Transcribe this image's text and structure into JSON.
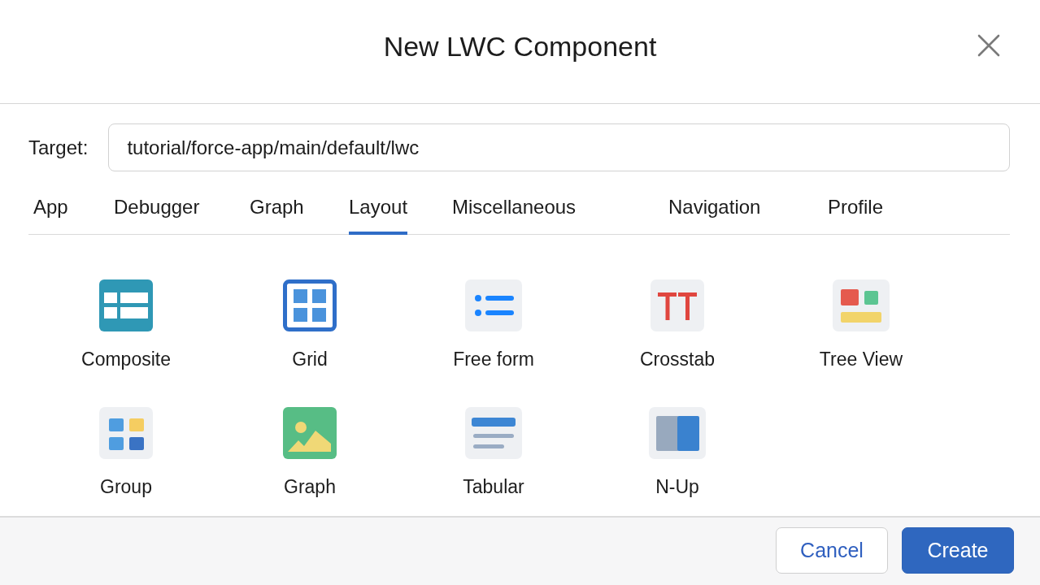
{
  "dialog": {
    "title": "New LWC Component"
  },
  "target": {
    "label": "Target:",
    "value": "tutorial/force-app/main/default/lwc"
  },
  "tabs": [
    {
      "label": "App",
      "selected": false
    },
    {
      "label": "Debugger",
      "selected": false
    },
    {
      "label": "Graph",
      "selected": false
    },
    {
      "label": "Layout",
      "selected": true
    },
    {
      "label": "Miscellaneous",
      "selected": false
    },
    {
      "label": "Navigation",
      "selected": false
    },
    {
      "label": "Profile",
      "selected": false
    }
  ],
  "components": [
    "Composite",
    "Grid",
    "Free form",
    "Crosstab",
    "Tree View",
    "Group",
    "Graph",
    "Tabular",
    "N-Up"
  ],
  "buttons": [
    {
      "label": "Cancel",
      "kind": "secondary"
    },
    {
      "label": "Create",
      "kind": "primary"
    }
  ]
}
